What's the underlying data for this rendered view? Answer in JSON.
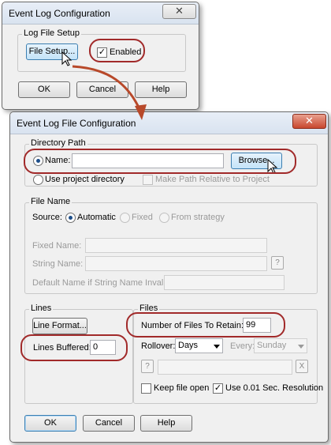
{
  "w1": {
    "title": "Event Log Configuration",
    "group_label": "Log File Setup",
    "file_setup_label": "File Setup...",
    "enabled_label": "Enabled",
    "enabled_checked": true,
    "ok_label": "OK",
    "cancel_label": "Cancel",
    "help_label": "Help"
  },
  "w2": {
    "title": "Event Log File Configuration",
    "dir": {
      "label": "Directory Path",
      "name_label": "Name:",
      "name_value": "",
      "browse_label": "Browse...",
      "use_project_label": "Use project directory",
      "make_relative_label": "Make Path Relative to Project"
    },
    "filename": {
      "label": "File Name",
      "source_label": "Source:",
      "automatic_label": "Automatic",
      "fixed_label": "Fixed",
      "strategy_label": "From strategy",
      "fixed_name_label": "Fixed Name:",
      "string_name_label": "String Name:",
      "string_help": "?",
      "default_name_label": "Default Name if String Name Invalid:"
    },
    "lines": {
      "label": "Lines",
      "line_format_label": "Line Format...",
      "lines_buffered_label": "Lines Buffered:",
      "lines_buffered_value": "0"
    },
    "files": {
      "label": "Files",
      "retain_label": "Number of Files To Retain:",
      "retain_value": "99",
      "rollover_label": "Rollover:",
      "rollover_value": "Days",
      "every_label": "Every:",
      "every_value": "Sunday",
      "help_q": "?",
      "clear_x": "X",
      "keep_open_label": "Keep file open",
      "resolution_label": "Use 0.01 Sec. Resolution",
      "resolution_checked": true
    },
    "ok_label": "OK",
    "cancel_label": "Cancel",
    "help_label": "Help"
  },
  "colors": {
    "callout": "#a12a2a",
    "arrow": "#b8492a"
  }
}
